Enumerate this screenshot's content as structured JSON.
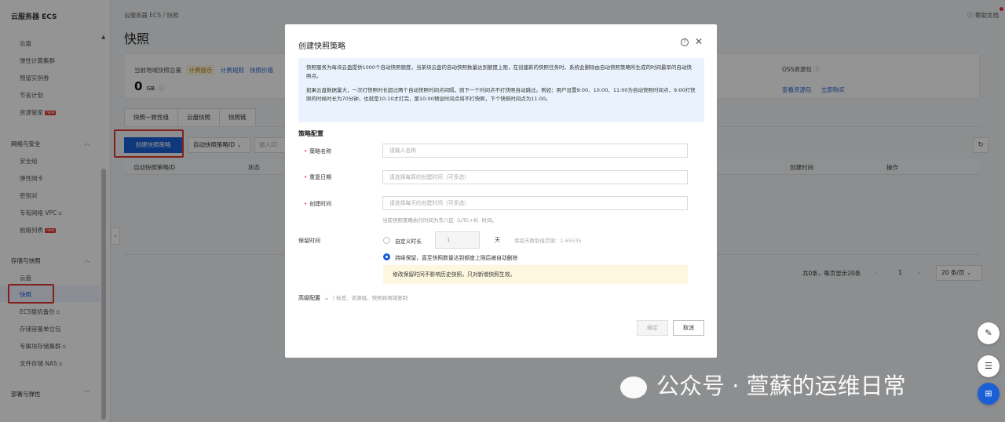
{
  "sidebar": {
    "title": "云服务器 ECS",
    "items_top": [
      "云盘",
      "弹性计算集群",
      "预留实例券",
      "节省计划",
      "资源管家"
    ],
    "network_group": "网络与安全",
    "network_items": [
      "安全组",
      "弹性网卡",
      "密钥对",
      "专有网络 VPC",
      "前缀列表"
    ],
    "storage_group": "存储与快照",
    "storage_items": [
      "云盘",
      "快照",
      "ECS整机备份",
      "存储容量单位包",
      "专属块存储集群",
      "文件存储 NAS"
    ],
    "deploy_group": "部署与弹性",
    "new_badge": "new"
  },
  "header": {
    "breadcrumb": "云服务器 ECS  /  快照",
    "title": "快照",
    "help": "帮助文档"
  },
  "summary": {
    "label": "当前地域快照总量",
    "tag": "计费提示",
    "link1": "计费规则",
    "link2": "快照价格",
    "value": "0",
    "unit": "GB",
    "oss_label": "OSS资源包",
    "oss_link1": "查看资源包",
    "oss_link2": "立即购买"
  },
  "tabs": [
    "快照一致性组",
    "云盘快照",
    "快照链"
  ],
  "toolbar": {
    "create": "创建快照策略",
    "filter": "自动快照策略ID",
    "filter_placeholder": "输入ID"
  },
  "table": {
    "col_id": "自动快照策略ID",
    "col_status": "状态",
    "col_created": "创建时间",
    "col_ops": "操作"
  },
  "pager": {
    "total": "共0条，每页显示20条",
    "current": "1",
    "size": "20 条/页"
  },
  "modal": {
    "title": "创建快照策略",
    "notice1": "快照服务为每块云盘提供1000个自动快照额度，当某块云盘的自动快照数量达到额度上限，在创建新的快照任务时，系统会删除由自动快照策略所生成的时间最早的自动快照点。",
    "notice2": "如果云盘数据量大，一次打快照时长超过两个自动快照时间点间隔，则下一个时间点不打快照自动跳过。例如：用户设置9:00、10:00、11:00为自动快照时间点，9:00打快照的时候时长为70分钟，也就是10:10才打完，那10:00预设时间点将不打快照，下个快照时间点为11:00。",
    "section": "策略配置",
    "name_label": "策略名称",
    "name_placeholder": "请输入名称",
    "repeat_label": "重复日期",
    "repeat_placeholder": "请选择每周的创建时间（可多选）",
    "time_label": "创建时间",
    "time_placeholder": "请选择每天的创建时间（可多选）",
    "time_hint": "当前快照策略执行时间为东八区（UTC+8）时间。",
    "retention_label": "保留时间",
    "opt_custom": "自定义时长",
    "custom_value": "1",
    "day_unit": "天",
    "range_hint": "保留天数取值范围：1-65535",
    "opt_keep": "持续保留，直至快照数量达到额度上限后被自动删除",
    "warn": "修改保留时间不影响历史快照，只对新增快照生效。",
    "advanced": "高级配置",
    "advanced_sub": "| 标签、资源组、快照跨地域复制",
    "ok": "确定",
    "cancel": "取消"
  },
  "watermark": "公众号 · 萱蘇的运维日常"
}
